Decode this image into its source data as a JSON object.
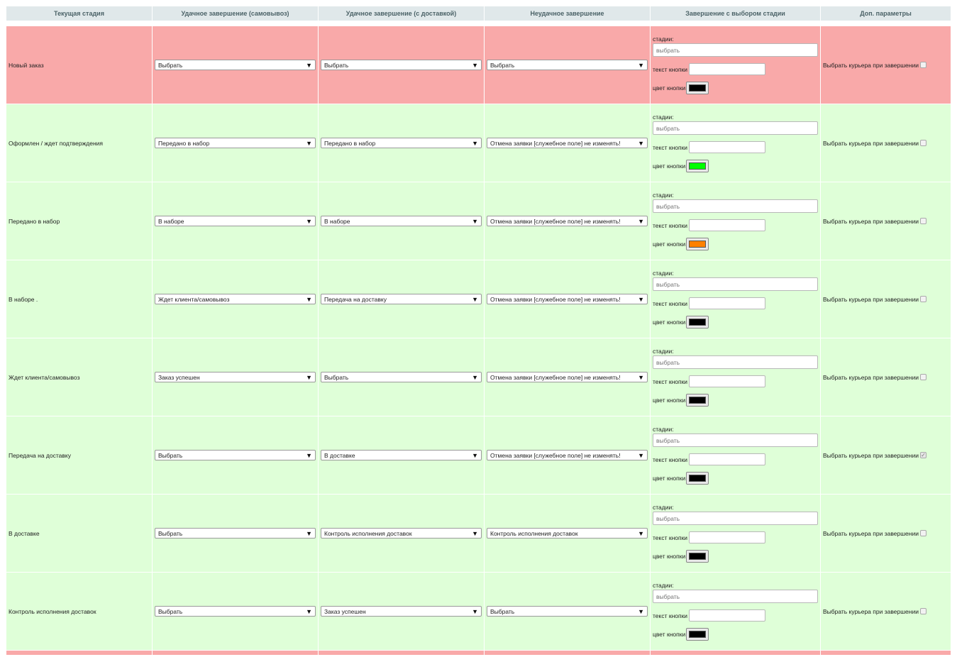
{
  "headers": [
    "Текущая стадия",
    "Удачное завершение (самовывоз)",
    "Удачное завершение (с доставкой)",
    "Неудачное завершение",
    "Завершение с выбором стадии",
    "Доп. параметры"
  ],
  "labels": {
    "stages": "стадии:",
    "stages_placeholder": "выбрать",
    "button_text": "текст кнопки",
    "button_color": "цвет кнопки",
    "courier": "Выбрать курьера при завершении",
    "dropdown_arrow": "▼"
  },
  "rows": [
    {
      "stage": "Новый заказ",
      "pickup": "Выбрать",
      "delivery": "Выбрать",
      "fail": "Выбрать",
      "button_text": "",
      "color": "#000000",
      "courier_checked": false,
      "row_color": "red"
    },
    {
      "stage": "Оформлен / ждет подтверждения",
      "pickup": "Передано в набор",
      "delivery": "Передано в набор",
      "fail": "Отмена заявки [служебное поле] не изменять!",
      "button_text": "",
      "color": "#00ff00",
      "courier_checked": false,
      "row_color": "green"
    },
    {
      "stage": "Передано в набор",
      "pickup": "В наборе",
      "delivery": "В наборе",
      "fail": "Отмена заявки [служебное поле] не изменять!",
      "button_text": "",
      "color": "#ff8000",
      "courier_checked": false,
      "row_color": "green"
    },
    {
      "stage": "В наборе .",
      "pickup": "Ждет клиента/самовывоз",
      "delivery": "Передача на доставку",
      "fail": "Отмена заявки [служебное поле] не изменять!",
      "button_text": "",
      "color": "#000000",
      "courier_checked": false,
      "row_color": "green"
    },
    {
      "stage": "Ждет клиента/самовывоз",
      "pickup": "Заказ успешен",
      "delivery": "Выбрать",
      "fail": "Отмена заявки [служебное поле] не изменять!",
      "button_text": "",
      "color": "#000000",
      "courier_checked": false,
      "row_color": "green"
    },
    {
      "stage": "Передача на доставку",
      "pickup": "Выбрать",
      "delivery": "В доставке",
      "fail": "Отмена заявки [служебное поле] не изменять!",
      "button_text": "",
      "color": "#000000",
      "courier_checked": true,
      "row_color": "green"
    },
    {
      "stage": "В доставке",
      "pickup": "Выбрать",
      "delivery": "Контроль исполнения доставок",
      "fail": "Контроль исполнения доставок",
      "button_text": "",
      "color": "#000000",
      "courier_checked": false,
      "row_color": "green"
    },
    {
      "stage": "Контроль исполнения доставок",
      "pickup": "Выбрать",
      "delivery": "Заказ успешен",
      "fail": "Выбрать",
      "button_text": "",
      "color": "#000000",
      "courier_checked": false,
      "row_color": "green"
    }
  ]
}
